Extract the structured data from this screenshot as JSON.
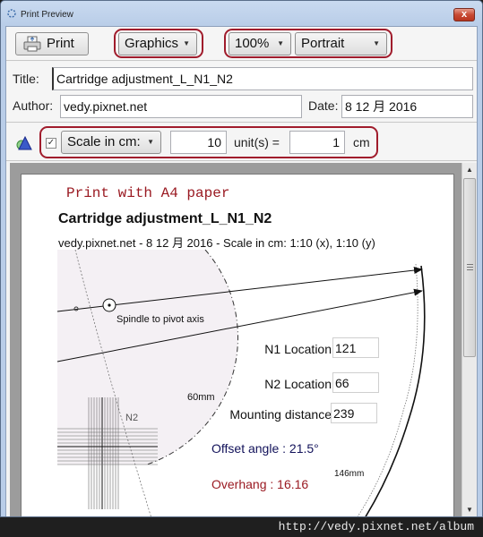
{
  "window": {
    "title": "Print Preview",
    "close_label": "x"
  },
  "toolbar": {
    "print_label": "Print",
    "mode_select": "Graphics",
    "zoom_select": "100%",
    "orientation_select": "Portrait"
  },
  "meta": {
    "title_label": "Title:",
    "title_value": "Cartridge adjustment_L_N1_N2",
    "author_label": "Author:",
    "author_value": "vedy.pixnet.net",
    "date_label": "Date:",
    "date_value": "8 12 月 2016"
  },
  "scale": {
    "checked": true,
    "mode_select": "Scale in cm:",
    "units_value": "10",
    "units_label": "unit(s) =",
    "cm_value": "1",
    "cm_label": "cm"
  },
  "page": {
    "note": "Print with A4 paper",
    "title": "Cartridge adjustment_L_N1_N2",
    "subtitle": "vedy.pixnet.net - 8 12 月 2016 - Scale in cm: 1:10 (x), 1:10 (y)",
    "spindle_label": "Spindle to pivot axis",
    "n1_label": "N1 Location",
    "n1_value": "121",
    "n2_label": "N2 Location",
    "n2_value": "66",
    "mounting_label": "Mounting distance",
    "mounting_value": "239",
    "offset_text": "Offset angle : 21.5°",
    "overhang_text": "Overhang : 16.16",
    "r60_label": "60mm",
    "r146_label": "146mm",
    "n2_marker": "N2"
  },
  "colors": {
    "annotation_red": "#a01c2c",
    "offset_blue": "#12125a",
    "overhang_red": "#9a1a22"
  },
  "statusbar": {
    "url": "http://vedy.pixnet.net/album"
  }
}
